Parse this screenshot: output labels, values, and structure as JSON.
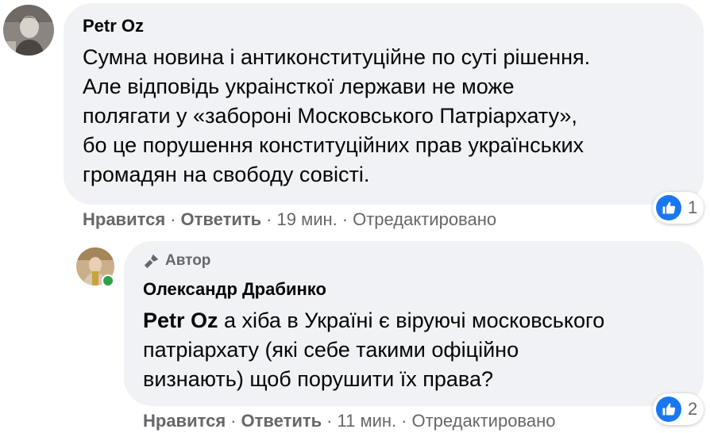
{
  "comment1": {
    "author": "Petr Oz",
    "lines": [
      "Сумна новина і антиконституційне по суті рішення.",
      "Але відповідь украінсткої лержави не може",
      "полягати у «забороні Московського Патріархату»,",
      "бо це порушення конституційних прав українських",
      "громадян на свободу совісті."
    ],
    "actions": {
      "like": "Нравится",
      "reply": "Ответить",
      "time": "19 мин.",
      "edited": "Отредактировано"
    },
    "reactions": {
      "count": "1",
      "type": "like-icon"
    }
  },
  "comment2": {
    "badge": "Автор",
    "author": "Олександр Драбинко",
    "mention": "Petr Oz",
    "first_line_rest": " а хіба в Україні є віруючі московського",
    "lines": [
      "патріархату (які себе такими офіційно",
      "визнають) щоб порушити їх права?"
    ],
    "actions": {
      "like": "Нравится",
      "reply": "Ответить",
      "time": "11 мин.",
      "edited": "Отредактировано"
    },
    "reactions": {
      "count": "2",
      "type": "like-icon"
    }
  },
  "colors": {
    "bubble": "#f0f2f5",
    "meta": "#65676b",
    "like": "#1877f2",
    "online": "#31a24c"
  }
}
